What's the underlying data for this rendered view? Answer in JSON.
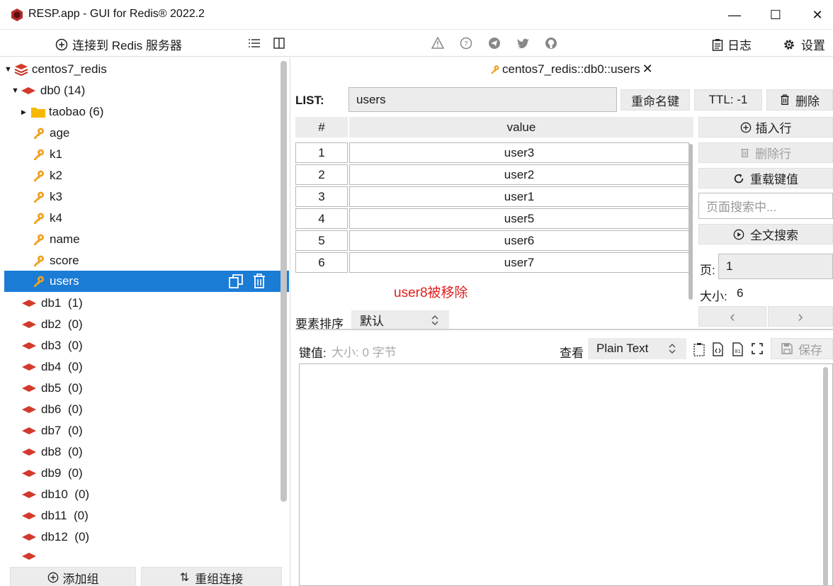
{
  "window": {
    "title": "RESP.app - GUI for Redis® 2022.2",
    "minimize": "—",
    "maximize": "☐",
    "close": "✕"
  },
  "left_toolbar": {
    "connect_label": "连接到 Redis 服务器"
  },
  "tree": {
    "connection": "centos7_redis",
    "db0_label": "db0",
    "db0_count": "(14)",
    "folder": "taobao (6)",
    "keys": [
      "age",
      "k1",
      "k2",
      "k3",
      "k4",
      "name",
      "score",
      "users"
    ],
    "dbs": [
      {
        "name": "db1",
        "count": "(1)"
      },
      {
        "name": "db2",
        "count": "(0)"
      },
      {
        "name": "db3",
        "count": "(0)"
      },
      {
        "name": "db4",
        "count": "(0)"
      },
      {
        "name": "db5",
        "count": "(0)"
      },
      {
        "name": "db6",
        "count": "(0)"
      },
      {
        "name": "db7",
        "count": "(0)"
      },
      {
        "name": "db8",
        "count": "(0)"
      },
      {
        "name": "db9",
        "count": "(0)"
      },
      {
        "name": "db10",
        "count": "(0)"
      },
      {
        "name": "db11",
        "count": "(0)"
      },
      {
        "name": "db12",
        "count": "(0)"
      }
    ],
    "selected_color": "#1b7cd6"
  },
  "bottom_buttons": {
    "add_group": "添加组",
    "reconnect": "重组连接"
  },
  "right_toolbar": {
    "log_label": "日志",
    "settings_label": "设置"
  },
  "tab": {
    "label": "centos7_redis::db0::users",
    "close": "✕"
  },
  "key_header": {
    "type_label": "LIST:",
    "key_name": "users",
    "rename_label": "重命名键",
    "ttl_label": "TTL:  -1",
    "delete_label": "删除"
  },
  "table": {
    "col_index": "#",
    "col_value": "value",
    "rows": [
      {
        "index": "1",
        "value": "user3"
      },
      {
        "index": "2",
        "value": "user2"
      },
      {
        "index": "3",
        "value": "user1"
      },
      {
        "index": "4",
        "value": "user5"
      },
      {
        "index": "5",
        "value": "user6"
      },
      {
        "index": "6",
        "value": "user7"
      }
    ]
  },
  "annotation": {
    "text": "user8被移除",
    "color": "#e02020"
  },
  "side_actions": {
    "insert_row": "插入行",
    "delete_row": "删除行",
    "reload": "重载键值",
    "page_search_placeholder": "页面搜索中...",
    "full_search": "全文搜索",
    "page_label": "页:",
    "page_value": "1",
    "size_label": "大小:",
    "size_value": "6",
    "prev": "‹",
    "next": "›"
  },
  "sort": {
    "label": "要素排序",
    "value": "默认"
  },
  "value_editor": {
    "label": "键值:",
    "size_hint": "大小: 0 字节",
    "view_label": "查看",
    "format": "Plain Text",
    "save_label": "保存"
  }
}
